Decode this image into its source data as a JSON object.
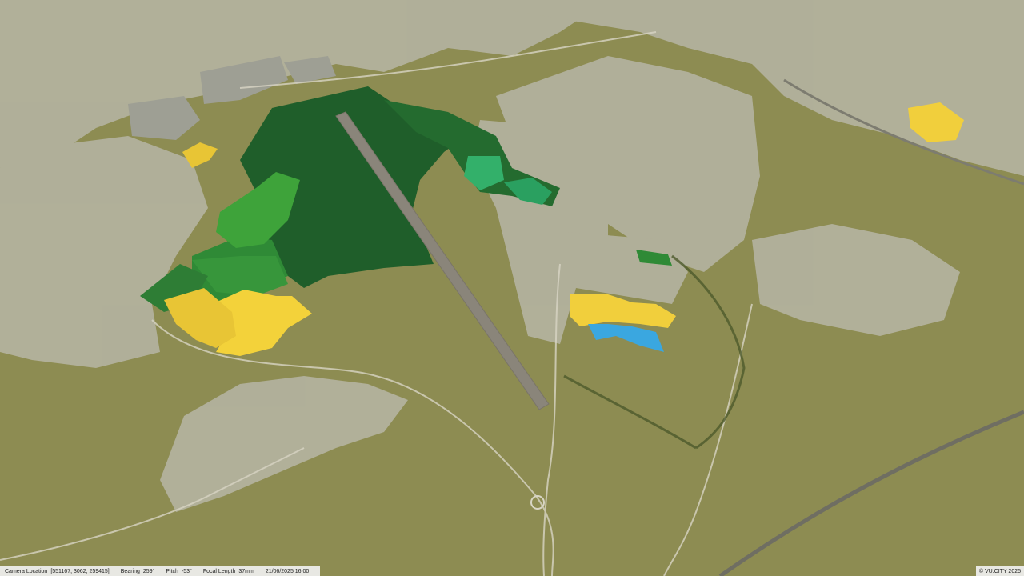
{
  "status": {
    "camera_location_label": "Camera Location",
    "camera_location_value": "[551167, 3062, 259415]",
    "bearing_label": "Bearing",
    "bearing_value": "259°",
    "pitch_label": "Pitch",
    "pitch_value": "-53°",
    "focal_label": "Focal Length",
    "focal_value": "37mm",
    "datetime": "21/06/2025 16:00"
  },
  "copyright": "© VU.CITY 2025",
  "colors": {
    "field": "#8d8c52",
    "dark_green_zone": "#1f5e2a",
    "mid_green_zone": "#2f8a36",
    "bright_green_zone": "#3ea33a",
    "teal_zone": "#33b06a",
    "yellow_zone": "#f3d23a",
    "blue_zone": "#3aa7e0",
    "runway": "#8a857a",
    "built_up": "#b9b8aa"
  },
  "icons": {
    "runway": "runway-icon"
  }
}
